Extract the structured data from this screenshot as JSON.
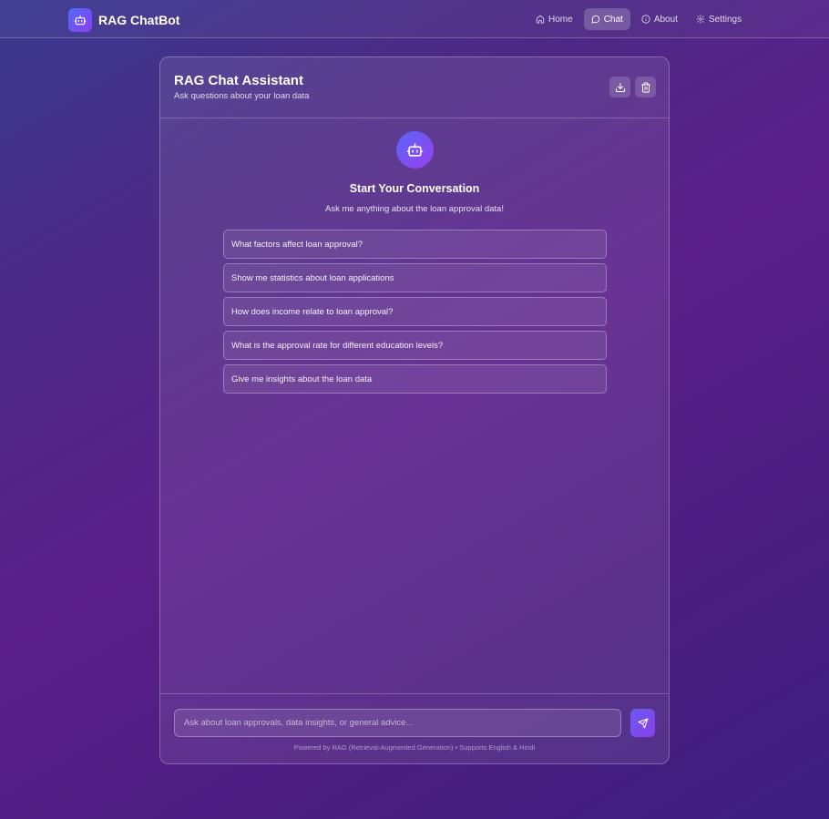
{
  "app": {
    "name": "RAG ChatBot",
    "logo_icon": "bot-icon"
  },
  "nav": {
    "items": [
      {
        "label": "Home",
        "icon": "home-icon",
        "active": false
      },
      {
        "label": "Chat",
        "icon": "chat-bubble-icon",
        "active": true
      },
      {
        "label": "About",
        "icon": "info-icon",
        "active": false
      },
      {
        "label": "Settings",
        "icon": "gear-icon",
        "active": false
      }
    ]
  },
  "chat": {
    "title": "RAG Chat Assistant",
    "subtitle": "Ask questions about your loan data",
    "actions": [
      {
        "icon": "download-icon"
      },
      {
        "icon": "trash-icon"
      }
    ],
    "empty_state": {
      "title": "Start Your Conversation",
      "subtitle": "Ask me anything about the loan approval data!"
    },
    "suggestions": [
      "What factors affect loan approval?",
      "Show me statistics about loan applications",
      "How does income relate to loan approval?",
      "What is the approval rate for different education levels?",
      "Give me insights about the loan data"
    ],
    "input": {
      "placeholder": "Ask about loan approvals, data insights, or general advice...",
      "value": ""
    },
    "send_icon": "send-icon",
    "footnote": "Powered by RAG (Retrieval-Augmented Generation) • Supports English & Hindi"
  },
  "colors": {
    "accent_start": "#4f6cf7",
    "accent_end": "#8a3df2",
    "background_top": "#3a3a8f",
    "background_mid": "#5a1f8a"
  }
}
